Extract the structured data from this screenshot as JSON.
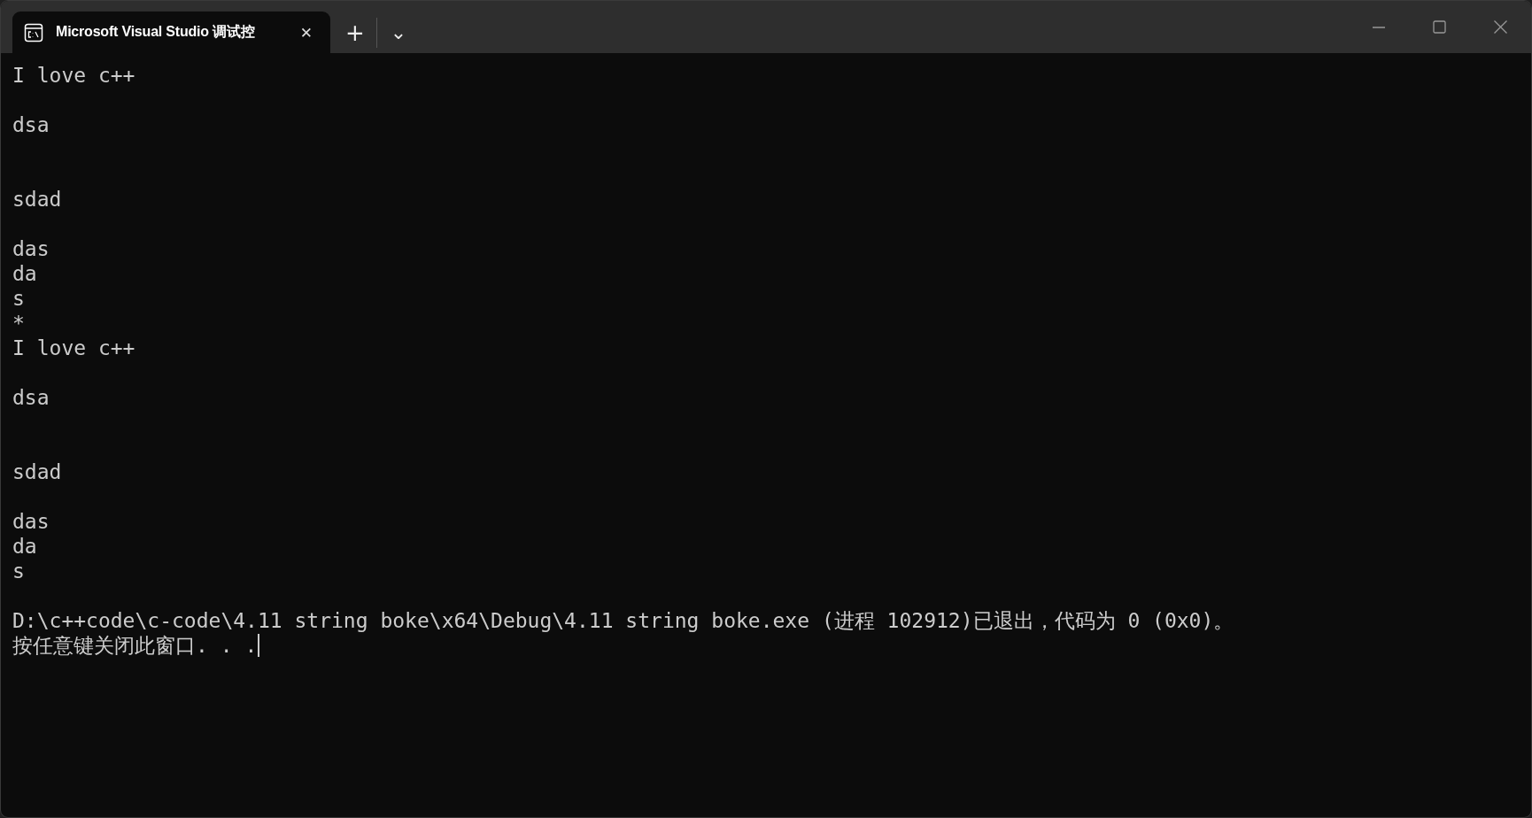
{
  "tabs": [
    {
      "title": "Microsoft Visual Studio 调试控",
      "selected": true,
      "close": "✕"
    }
  ],
  "tab_actions": {
    "new_tab": "+",
    "dropdown": "⌄"
  },
  "console": {
    "lines": [
      {
        "text": "I love c++",
        "kind": "line"
      },
      {
        "text": "dsa",
        "kind": "after-one-blank"
      },
      {
        "text": "sdad",
        "kind": "after-two-blanks"
      },
      {
        "text": "das",
        "kind": "after-one-blank"
      },
      {
        "text": "da",
        "kind": "line"
      },
      {
        "text": "s",
        "kind": "line"
      },
      {
        "text": "*",
        "kind": "line"
      },
      {
        "text": "I love c++",
        "kind": "line"
      },
      {
        "text": "dsa",
        "kind": "after-one-blank"
      },
      {
        "text": "sdad",
        "kind": "after-two-blanks"
      },
      {
        "text": "das",
        "kind": "after-one-blank"
      },
      {
        "text": "da",
        "kind": "line"
      },
      {
        "text": "s",
        "kind": "line"
      },
      {
        "text": "D:\\c++code\\c-code\\4.11 string boke\\x64\\Debug\\4.11 string boke.exe (进程 102912)已退出，代码为 0 (0x0)。",
        "kind": "after-one-blank"
      },
      {
        "text": "按任意键关闭此窗口. . .",
        "kind": "line"
      }
    ],
    "cursor": true
  }
}
